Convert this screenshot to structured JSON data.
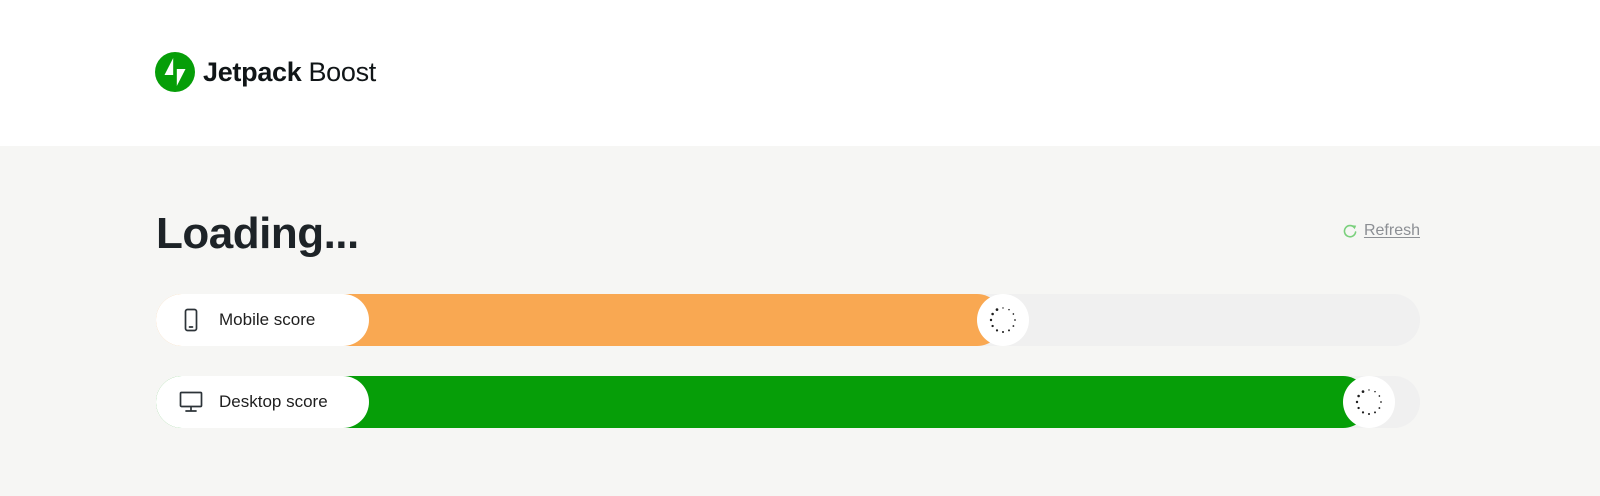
{
  "header": {
    "brand_strong": "Jetpack",
    "brand_light": "Boost",
    "logo_color": "#069e08"
  },
  "main": {
    "heading": "Loading...",
    "refresh_label": "Refresh"
  },
  "scores": [
    {
      "id": "mobile",
      "label": "Mobile score",
      "icon": "smartphone-icon",
      "bar_color": "#f9a852",
      "fill_fraction": 0.67
    },
    {
      "id": "desktop",
      "label": "Desktop score",
      "icon": "desktop-monitor-icon",
      "bar_color": "#069e08",
      "fill_fraction": 0.96
    }
  ],
  "colors": {
    "track": "#f0f0f0",
    "background": "#f6f6f4",
    "refresh_icon": "#7ad07c"
  }
}
